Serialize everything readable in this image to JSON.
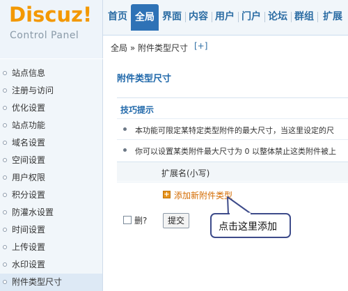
{
  "logo": {
    "main": "Discuz!",
    "sub": "Control Panel"
  },
  "topnav": {
    "items": [
      {
        "label": "首页"
      },
      {
        "label": "全局"
      },
      {
        "label": "界面"
      },
      {
        "label": "内容"
      },
      {
        "label": "用户"
      },
      {
        "label": "门户"
      },
      {
        "label": "论坛"
      },
      {
        "label": "群组"
      },
      {
        "label": "扩展"
      }
    ],
    "active": "全局"
  },
  "breadcrumb": {
    "text": "全局 » 附件类型尺寸",
    "plus": "[+]"
  },
  "sidebar": {
    "items": [
      {
        "label": "站点信息"
      },
      {
        "label": "注册与访问"
      },
      {
        "label": "优化设置"
      },
      {
        "label": "站点功能"
      },
      {
        "label": "域名设置"
      },
      {
        "label": "空间设置"
      },
      {
        "label": "用户权限"
      },
      {
        "label": "积分设置"
      },
      {
        "label": "防灌水设置"
      },
      {
        "label": "时间设置"
      },
      {
        "label": "上传设置"
      },
      {
        "label": "水印设置"
      },
      {
        "label": "附件类型尺寸"
      }
    ],
    "active": "附件类型尺寸"
  },
  "main": {
    "title": "附件类型尺寸",
    "tips_title": "技巧提示",
    "tips": [
      "本功能可限定某特定类型附件的最大尺寸，当这里设定的尺",
      "你可以设置某类附件最大尺寸为 0 以整体禁止这类附件被上"
    ],
    "column_ext": "扩展名(小写)",
    "add_label": "添加新附件类型",
    "delete_label": "删?",
    "submit_label": "提交"
  },
  "callout": {
    "text": "点击这里添加"
  },
  "colors": {
    "accent": "#2e72b6",
    "logo": "#f39800",
    "link_orange": "#d46b00",
    "callout_border": "#3d4b8a"
  }
}
